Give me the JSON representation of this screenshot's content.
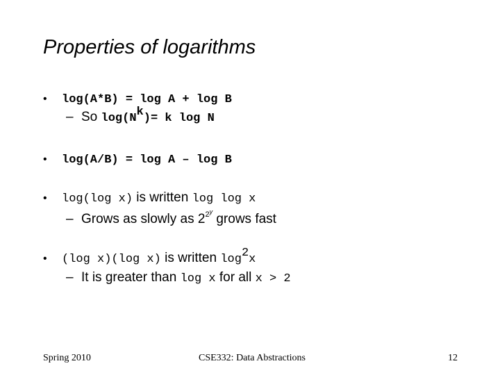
{
  "slide": {
    "title": "Properties of logarithms",
    "bullets": [
      {
        "bullet_char": "•",
        "text_code": "log(A*B) = log A + log B",
        "sub": {
          "dash": "–",
          "prefix": "So ",
          "code_before": "log(N",
          "code_sup": "k",
          "code_after": ")= k log N"
        }
      },
      {
        "bullet_char": "•",
        "text_code": "log(A/B) = log A – log B"
      },
      {
        "bullet_char": "•",
        "code1": "log(log x)",
        "text1": " is written ",
        "code2": "log log x",
        "sub": {
          "dash": "–",
          "text_before": "Grows as slowly as 2",
          "sup1": "2",
          "sup2": "y",
          "text_after": " grows fast"
        }
      },
      {
        "bullet_char": "•",
        "code1": "(log x)(log x)",
        "text1": " is written ",
        "code2_base": "log",
        "code2_sup": "2",
        "code2_after": "x",
        "sub": {
          "dash": "–",
          "text_before": "It is greater than ",
          "code1": "log x",
          "text_mid": " for all ",
          "code2": "x > 2"
        }
      }
    ],
    "footer": {
      "left": "Spring 2010",
      "center": "CSE332: Data Abstractions",
      "right": "12"
    }
  }
}
